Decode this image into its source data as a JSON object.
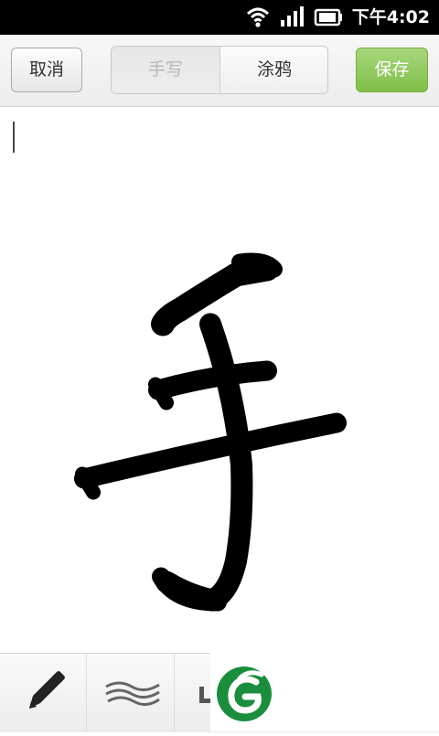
{
  "status_bar": {
    "time": "下午4:02",
    "icons": [
      "wifi-icon",
      "signal-icon",
      "battery-icon"
    ]
  },
  "title_bar": {
    "cancel_label": "取消",
    "tabs": [
      {
        "label": "手写",
        "active": true
      },
      {
        "label": "涂鸦",
        "active": false
      }
    ],
    "save_label": "保存"
  },
  "toolbar": {
    "tools": [
      "pen-icon",
      "wave-brush-icon",
      "line-tool-icon"
    ]
  },
  "colors": {
    "save_button": "#8cc657",
    "status_bar": "#000000",
    "logo_green": "#1b8e3d"
  }
}
